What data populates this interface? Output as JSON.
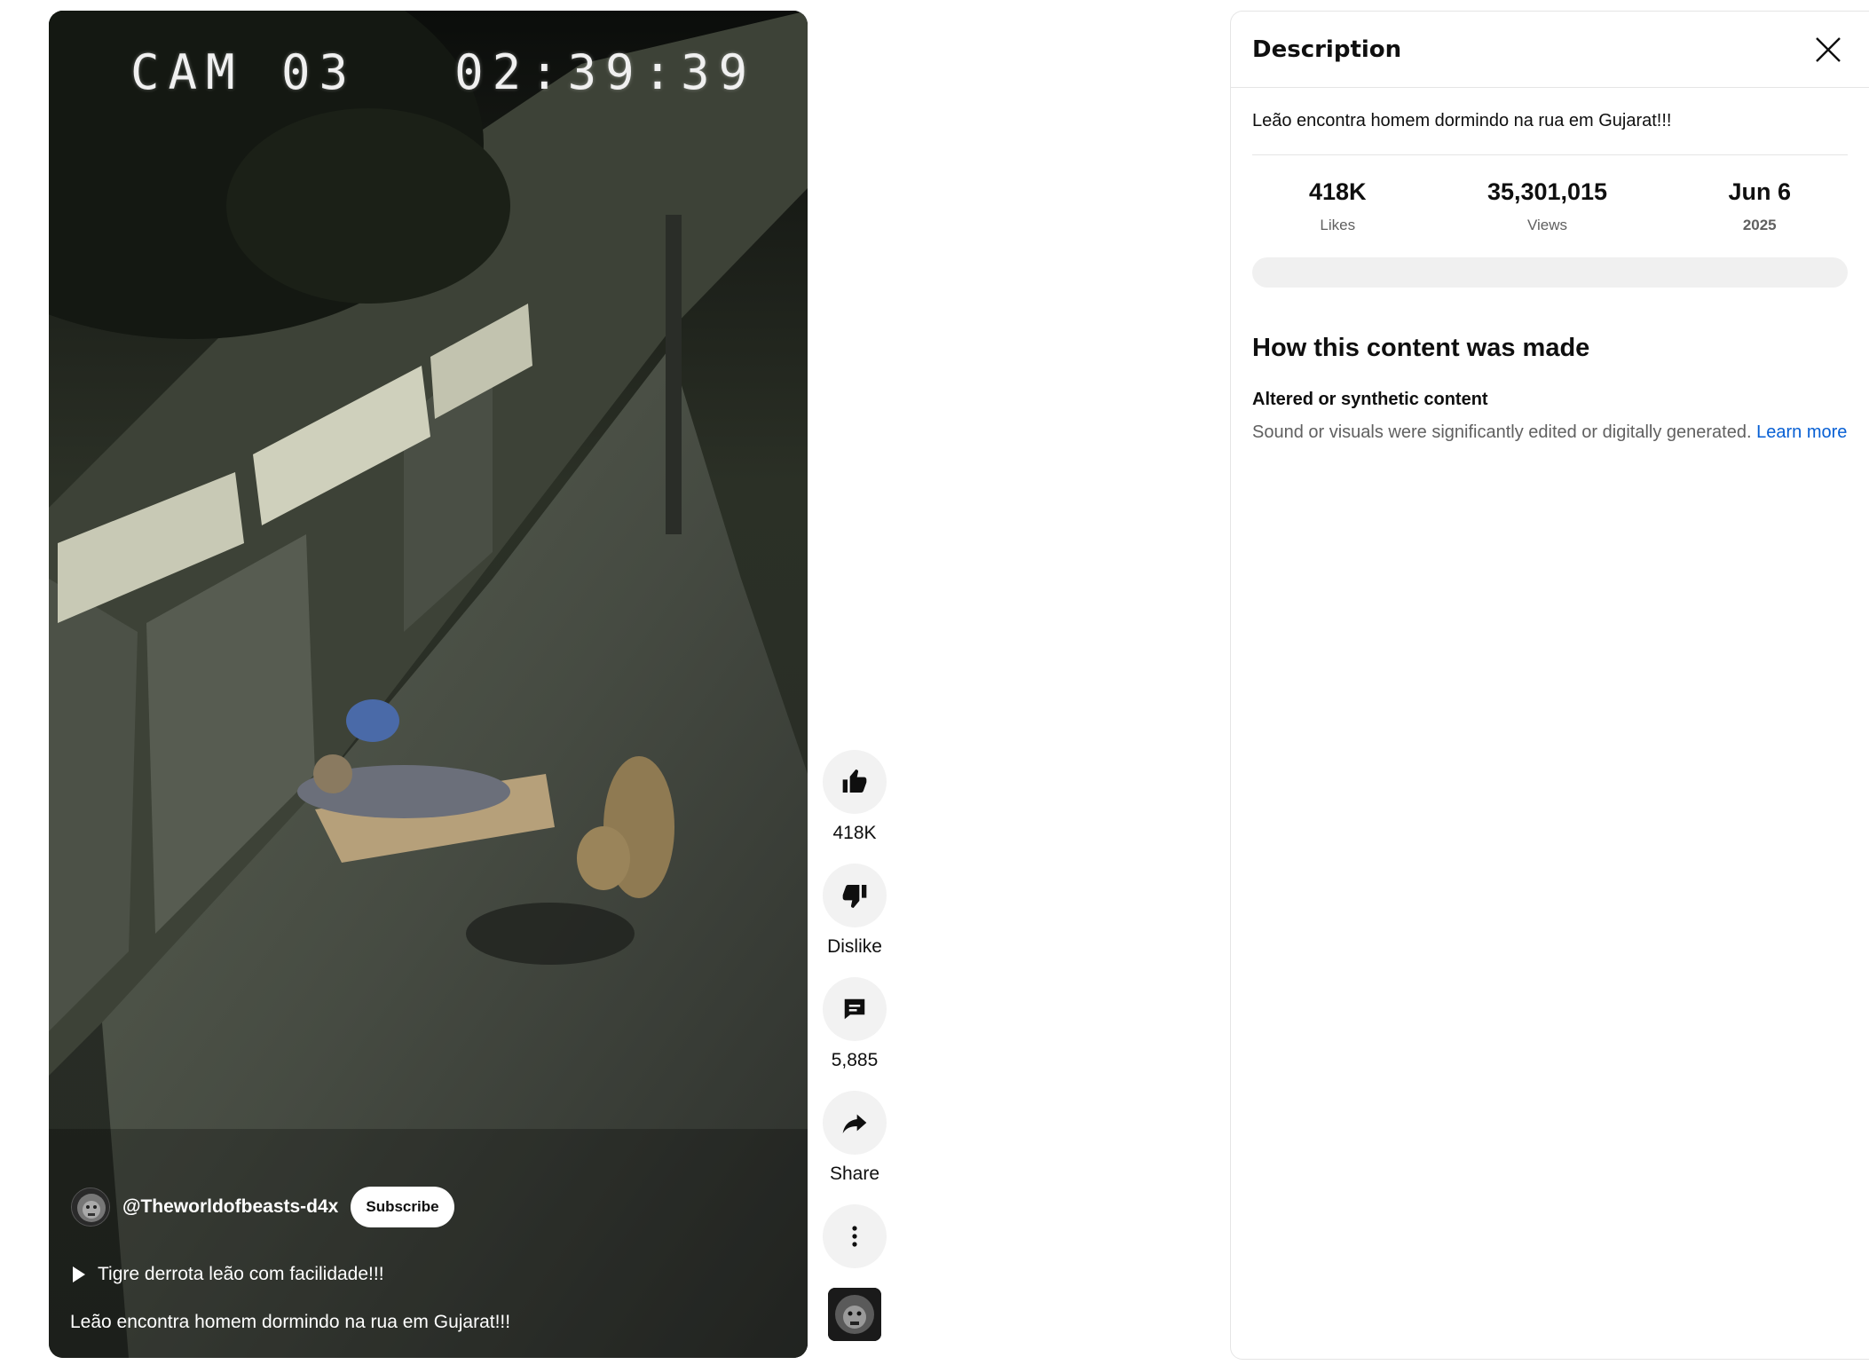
{
  "video": {
    "overlay": {
      "camera": "CAM 03",
      "timestamp": "02:39:39"
    },
    "channel": {
      "handle": "@Theworldofbeasts-d4x",
      "subscribe_label": "Subscribe"
    },
    "linked_video_title": "Tigre derrota leão com facilidade!!!",
    "caption": "Leão encontra homem dormindo na rua em Gujarat!!!"
  },
  "actions": {
    "like_count": "418K",
    "dislike_label": "Dislike",
    "comment_count": "5,885",
    "share_label": "Share"
  },
  "description_panel": {
    "title": "Description",
    "text": "Leão encontra homem dormindo na rua em Gujarat!!!",
    "stats": [
      {
        "value": "418K",
        "label": "Likes"
      },
      {
        "value": "35,301,015",
        "label": "Views"
      },
      {
        "value": "Jun 6",
        "label": "2025"
      }
    ],
    "how_made": {
      "heading": "How this content was made",
      "subheading": "Altered or synthetic content",
      "text": "Sound or visuals were significantly edited or digitally generated.",
      "link_label": "Learn more"
    }
  },
  "colors": {
    "link": "#065fd4",
    "action_bg": "#f2f2f2",
    "secondary_text": "#606060"
  }
}
